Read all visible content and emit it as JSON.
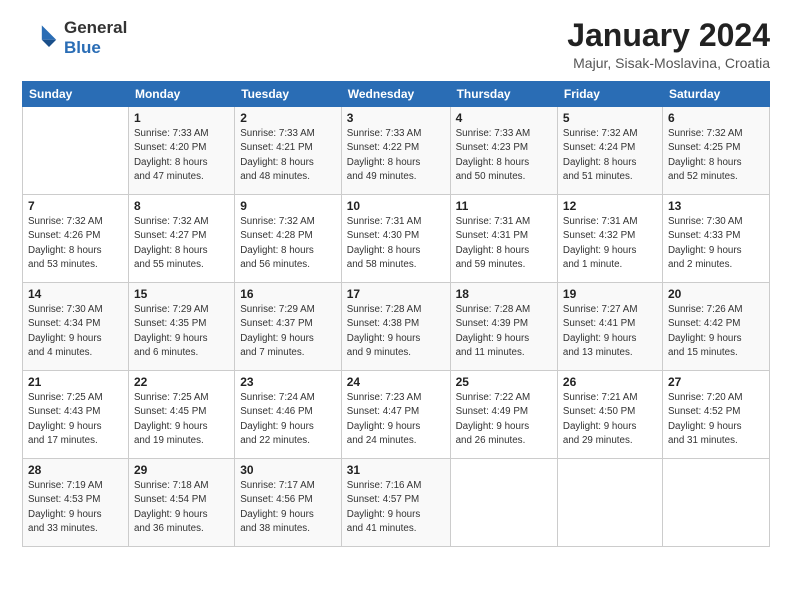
{
  "header": {
    "logo_general": "General",
    "logo_blue": "Blue",
    "title": "January 2024",
    "subtitle": "Majur, Sisak-Moslavina, Croatia"
  },
  "days_of_week": [
    "Sunday",
    "Monday",
    "Tuesday",
    "Wednesday",
    "Thursday",
    "Friday",
    "Saturday"
  ],
  "weeks": [
    [
      {
        "day": "",
        "info": ""
      },
      {
        "day": "1",
        "info": "Sunrise: 7:33 AM\nSunset: 4:20 PM\nDaylight: 8 hours\nand 47 minutes."
      },
      {
        "day": "2",
        "info": "Sunrise: 7:33 AM\nSunset: 4:21 PM\nDaylight: 8 hours\nand 48 minutes."
      },
      {
        "day": "3",
        "info": "Sunrise: 7:33 AM\nSunset: 4:22 PM\nDaylight: 8 hours\nand 49 minutes."
      },
      {
        "day": "4",
        "info": "Sunrise: 7:33 AM\nSunset: 4:23 PM\nDaylight: 8 hours\nand 50 minutes."
      },
      {
        "day": "5",
        "info": "Sunrise: 7:32 AM\nSunset: 4:24 PM\nDaylight: 8 hours\nand 51 minutes."
      },
      {
        "day": "6",
        "info": "Sunrise: 7:32 AM\nSunset: 4:25 PM\nDaylight: 8 hours\nand 52 minutes."
      }
    ],
    [
      {
        "day": "7",
        "info": "Sunrise: 7:32 AM\nSunset: 4:26 PM\nDaylight: 8 hours\nand 53 minutes."
      },
      {
        "day": "8",
        "info": "Sunrise: 7:32 AM\nSunset: 4:27 PM\nDaylight: 8 hours\nand 55 minutes."
      },
      {
        "day": "9",
        "info": "Sunrise: 7:32 AM\nSunset: 4:28 PM\nDaylight: 8 hours\nand 56 minutes."
      },
      {
        "day": "10",
        "info": "Sunrise: 7:31 AM\nSunset: 4:30 PM\nDaylight: 8 hours\nand 58 minutes."
      },
      {
        "day": "11",
        "info": "Sunrise: 7:31 AM\nSunset: 4:31 PM\nDaylight: 8 hours\nand 59 minutes."
      },
      {
        "day": "12",
        "info": "Sunrise: 7:31 AM\nSunset: 4:32 PM\nDaylight: 9 hours\nand 1 minute."
      },
      {
        "day": "13",
        "info": "Sunrise: 7:30 AM\nSunset: 4:33 PM\nDaylight: 9 hours\nand 2 minutes."
      }
    ],
    [
      {
        "day": "14",
        "info": "Sunrise: 7:30 AM\nSunset: 4:34 PM\nDaylight: 9 hours\nand 4 minutes."
      },
      {
        "day": "15",
        "info": "Sunrise: 7:29 AM\nSunset: 4:35 PM\nDaylight: 9 hours\nand 6 minutes."
      },
      {
        "day": "16",
        "info": "Sunrise: 7:29 AM\nSunset: 4:37 PM\nDaylight: 9 hours\nand 7 minutes."
      },
      {
        "day": "17",
        "info": "Sunrise: 7:28 AM\nSunset: 4:38 PM\nDaylight: 9 hours\nand 9 minutes."
      },
      {
        "day": "18",
        "info": "Sunrise: 7:28 AM\nSunset: 4:39 PM\nDaylight: 9 hours\nand 11 minutes."
      },
      {
        "day": "19",
        "info": "Sunrise: 7:27 AM\nSunset: 4:41 PM\nDaylight: 9 hours\nand 13 minutes."
      },
      {
        "day": "20",
        "info": "Sunrise: 7:26 AM\nSunset: 4:42 PM\nDaylight: 9 hours\nand 15 minutes."
      }
    ],
    [
      {
        "day": "21",
        "info": "Sunrise: 7:25 AM\nSunset: 4:43 PM\nDaylight: 9 hours\nand 17 minutes."
      },
      {
        "day": "22",
        "info": "Sunrise: 7:25 AM\nSunset: 4:45 PM\nDaylight: 9 hours\nand 19 minutes."
      },
      {
        "day": "23",
        "info": "Sunrise: 7:24 AM\nSunset: 4:46 PM\nDaylight: 9 hours\nand 22 minutes."
      },
      {
        "day": "24",
        "info": "Sunrise: 7:23 AM\nSunset: 4:47 PM\nDaylight: 9 hours\nand 24 minutes."
      },
      {
        "day": "25",
        "info": "Sunrise: 7:22 AM\nSunset: 4:49 PM\nDaylight: 9 hours\nand 26 minutes."
      },
      {
        "day": "26",
        "info": "Sunrise: 7:21 AM\nSunset: 4:50 PM\nDaylight: 9 hours\nand 29 minutes."
      },
      {
        "day": "27",
        "info": "Sunrise: 7:20 AM\nSunset: 4:52 PM\nDaylight: 9 hours\nand 31 minutes."
      }
    ],
    [
      {
        "day": "28",
        "info": "Sunrise: 7:19 AM\nSunset: 4:53 PM\nDaylight: 9 hours\nand 33 minutes."
      },
      {
        "day": "29",
        "info": "Sunrise: 7:18 AM\nSunset: 4:54 PM\nDaylight: 9 hours\nand 36 minutes."
      },
      {
        "day": "30",
        "info": "Sunrise: 7:17 AM\nSunset: 4:56 PM\nDaylight: 9 hours\nand 38 minutes."
      },
      {
        "day": "31",
        "info": "Sunrise: 7:16 AM\nSunset: 4:57 PM\nDaylight: 9 hours\nand 41 minutes."
      },
      {
        "day": "",
        "info": ""
      },
      {
        "day": "",
        "info": ""
      },
      {
        "day": "",
        "info": ""
      }
    ]
  ]
}
